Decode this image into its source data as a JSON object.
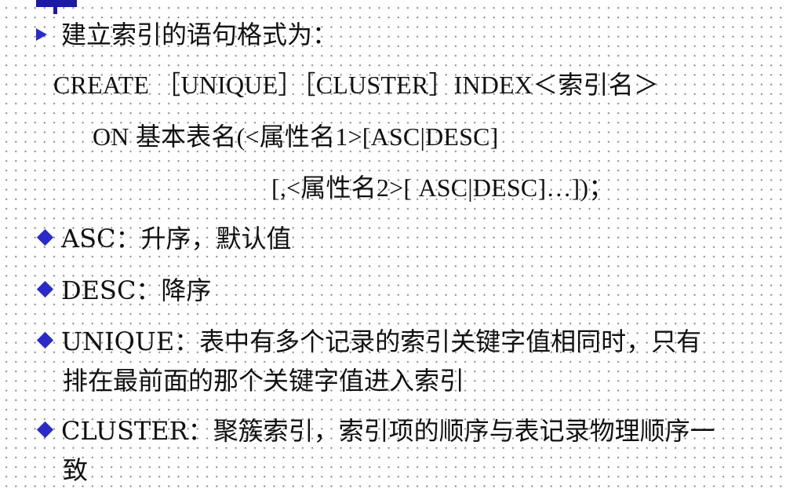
{
  "heading": "建立索引的语句格式为：",
  "syntax": {
    "line1": "CREATE ［UNIQUE］［CLUSTER］INDEX＜索引名＞",
    "line2": "ON 基本表名(<属性名1>[ASC|DESC]",
    "line3": "[,<属性名2>[ ASC|DESC]…])；"
  },
  "bullets": [
    {
      "text": "ASC：升序，默认值"
    },
    {
      "text": "DESC：降序"
    },
    {
      "text": "UNIQUE：表中有多个记录的索引关键字值相同时，只有",
      "text2": "排在最前面的那个关键字值进入索引"
    },
    {
      "text": "CLUSTER：聚簇索引，索引项的顺序与表记录物理顺序一",
      "text2": "致"
    }
  ],
  "colors": {
    "bullet": "#2a2acb",
    "mark": "#1a1aa6",
    "text": "#111111"
  },
  "icons": {
    "heading_bullet": "arrow-icon",
    "list_bullet": "diamond-icon"
  }
}
